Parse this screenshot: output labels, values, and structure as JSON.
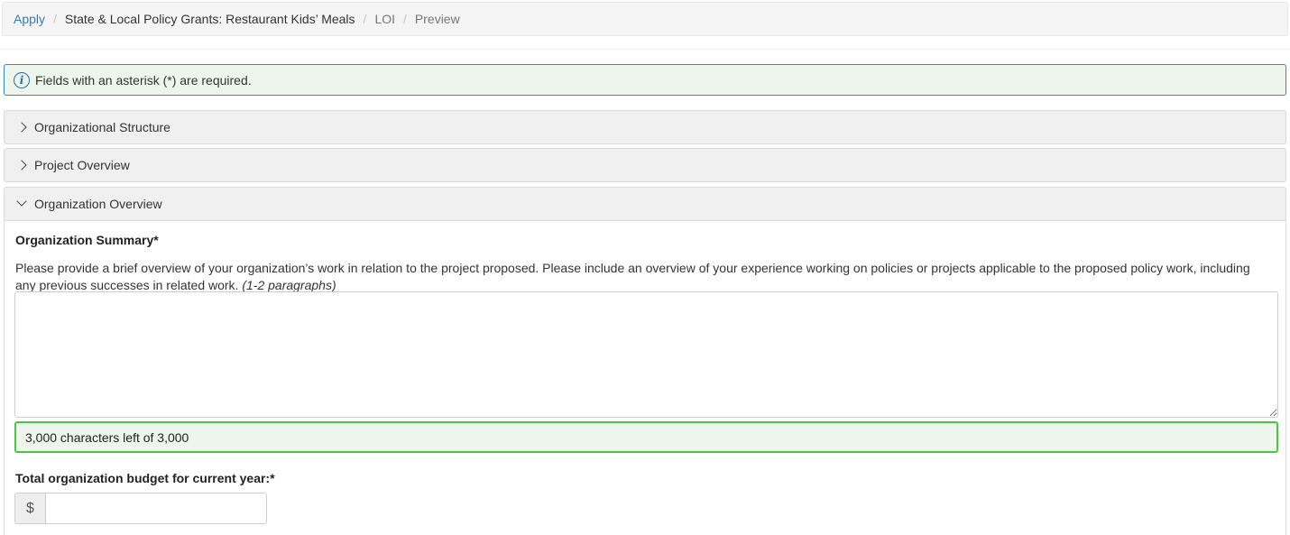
{
  "breadcrumb": {
    "apply": "Apply",
    "program": "State & Local Policy Grants: Restaurant Kids’ Meals",
    "loi": "LOI",
    "preview": "Preview",
    "separator": "/"
  },
  "alert": {
    "icon": "info-icon",
    "text": "Fields with an asterisk (*) are required."
  },
  "sections": {
    "organizational_structure": {
      "label": "Organizational Structure",
      "expanded": false
    },
    "project_overview": {
      "label": "Project Overview",
      "expanded": false
    },
    "organization_overview": {
      "label": "Organization Overview",
      "expanded": true
    }
  },
  "organization_summary": {
    "label": "Organization Summary*",
    "help": "Please provide a brief overview of your organization’s work in relation to the project proposed. Please include an overview of your experience working on policies or projects applicable to the proposed policy work, including any previous successes in related work.",
    "help_hint": "(1-2 paragraphs)",
    "value": "",
    "char_count": "3,000 characters left of 3,000"
  },
  "budget": {
    "label": "Total organization budget for current year:*",
    "currency_symbol": "$",
    "value": ""
  },
  "colors": {
    "link": "#337ab7",
    "alert_border": "#3a87c8",
    "counter_border": "#49c73f",
    "alert_bg": "#eef5ec"
  }
}
